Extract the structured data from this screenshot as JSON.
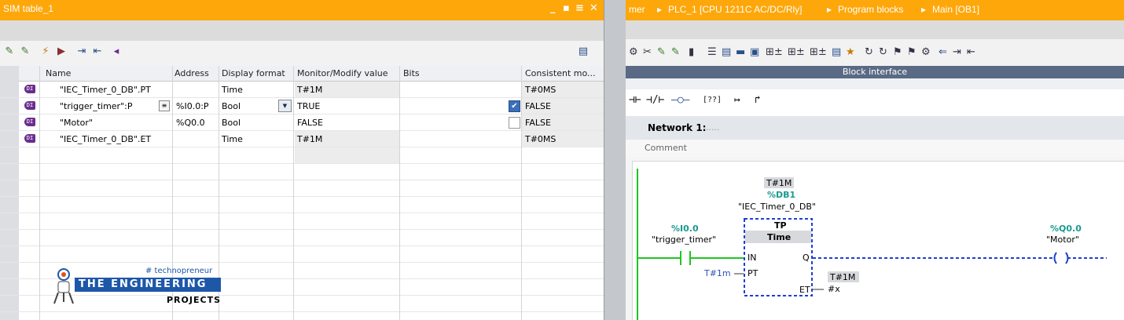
{
  "left_window": {
    "title": "SIM table_1",
    "controls": [
      "_",
      "▪",
      "≡",
      "✕"
    ],
    "columns": [
      "Name",
      "Address",
      "Display format",
      "Monitor/Modify value",
      "Bits",
      "Consistent mo..."
    ],
    "rows": [
      {
        "name": "\"IEC_Timer_0_DB\".PT",
        "address": "",
        "format": "Time",
        "monitor": "T#1M",
        "bits_checked": null,
        "consistent": "T#0MS"
      },
      {
        "name": "\"trigger_timer\":P",
        "address": "%I0.0:P",
        "format": "Bool",
        "monitor": "TRUE",
        "bits_checked": true,
        "consistent": "FALSE"
      },
      {
        "name": "\"Motor\"",
        "address": "%Q0.0",
        "format": "Bool",
        "monitor": "FALSE",
        "bits_checked": false,
        "consistent": "FALSE"
      },
      {
        "name": "\"IEC_Timer_0_DB\".ET",
        "address": "",
        "format": "Time",
        "monitor": "T#1M",
        "bits_checked": null,
        "consistent": "T#0MS"
      }
    ],
    "tag_icon_text": "DI",
    "logo": {
      "hashtag": "# technopreneur",
      "main": "THE ENGINEERING",
      "sub": "PROJECTS"
    }
  },
  "right_window": {
    "breadcrumb": [
      "mer",
      "PLC_1 [CPU 1211C AC/DC/Rly]",
      "Program blocks",
      "Main [OB1]"
    ],
    "block_interface_label": "Block interface",
    "ladder_toolbar": [
      "⊣⊢",
      "⊣/⊢",
      "–○–",
      "[??]",
      "↦",
      "↱"
    ],
    "network": {
      "label": "Network 1:",
      "title_placeholder": ".....",
      "comment": "Comment"
    },
    "diagram": {
      "timer_preset_top": "T#1M",
      "db_address": "%DB1",
      "db_name": "\"IEC_Timer_0_DB\"",
      "block_type": "TP",
      "block_subtype": "Time",
      "pin_in": "IN",
      "pin_pt": "PT",
      "pin_q": "Q",
      "pin_et": "ET",
      "pt_value": "T#1m",
      "et_value": "T#1M",
      "et_target": "#x",
      "contact_address": "%I0.0",
      "contact_name": "\"trigger_timer\"",
      "coil_address": "%Q0.0",
      "coil_name": "\"Motor\""
    }
  },
  "colors": {
    "titlebar": "#fea70a",
    "teal": "#1a9a8f",
    "dashed_blue": "#1e3fd1",
    "green_rail": "#22c322"
  }
}
